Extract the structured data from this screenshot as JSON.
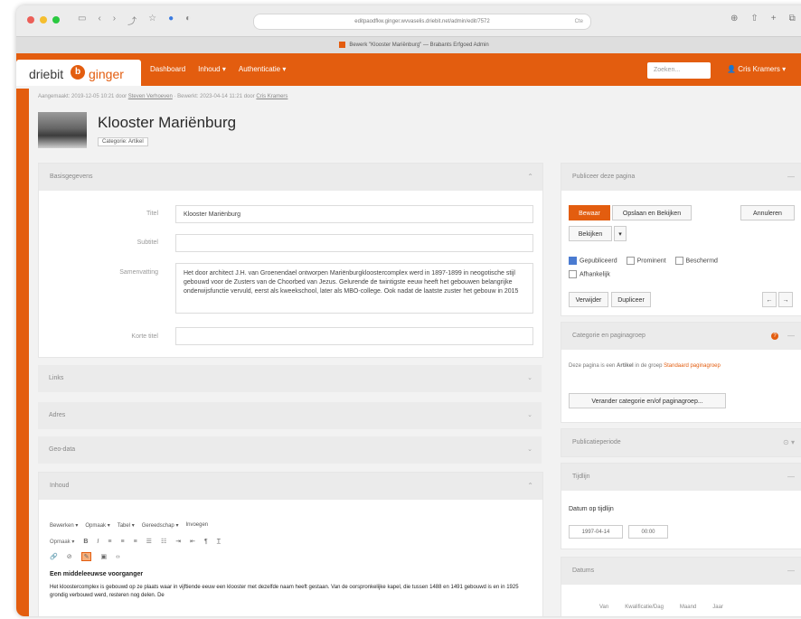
{
  "browser": {
    "url": "editpaodfkw.ginger.wvvaselis.driebit.net/admin/edit/7572",
    "url_right": "Cte",
    "tab_title": "Bewerk \"Klooster Mariënburg\" — Brabants Erfgoed Admin"
  },
  "nav": {
    "logo_left": "driebit",
    "logo_badge": "b",
    "logo_right": "ginger",
    "links": [
      "Dashboard",
      "Inhoud ▾",
      "Authenticatie ▾"
    ],
    "search_placeholder": "Zoeken...",
    "user": "Cris Kramers ▾"
  },
  "sidebar_label": "",
  "page": {
    "meta_prefix": "Aangemaakt: 2019-12-05 10:21 door",
    "meta_user1": "Steven Verhoeven",
    "meta_mid": "· Bewerkt: 2023-04-14 11:21 door",
    "meta_user2": "Cris Kramers",
    "title": "Klooster Mariënburg",
    "category": "Categorie: Artikel"
  },
  "basics": {
    "header": "Basisgegevens",
    "title_label": "Titel",
    "title_value": "Klooster Mariënburg",
    "subtitle_label": "Subtitel",
    "subtitle_value": "",
    "summary_label": "Samenvatting",
    "summary_value": "Het door architect J.H. van Groenendael ontworpen Mariënburgkloostercomplex werd in 1897-1899 in neogotische stijl gebouwd voor de Zusters van de Choorbed van Jezus. Gelurende de twintigste eeuw heeft het gebouwen belangrijke onderwijsfunctie vervuld, eerst als kweekschool, later als MBO-college. Ook nadat de laatste zuster het gebouw in 2015",
    "short_label": "Korte titel",
    "short_value": ""
  },
  "sections": [
    "Links",
    "Adres",
    "Geo-data"
  ],
  "content": {
    "header": "Inhoud",
    "menus": [
      "Bewerken ▾",
      "Opmaak ▾",
      "Tabel ▾",
      "Gereedschap ▾",
      "Invoegen"
    ],
    "format": "Opmaak ▾",
    "heading": "Een middeleeuwse voorganger",
    "para": "Het kloostercomplex is gebouwd op ze plaats waar in vijftiende eeuw een klooster met dezelfde naam heeft gestaan. Van de oorspronkelijke kapel, die tussen 1488 en 1491 gebouwd is en in 1925 grondig verbouwd werd, resteren nog delen. De"
  },
  "publish": {
    "header": "Publiceer deze pagina",
    "save": "Bewaar",
    "save_view": "Opslaan en Bekijken",
    "cancel": "Annuleren",
    "view": "Bekijken",
    "view_more": "▾",
    "published": "Gepubliceerd",
    "prominent": "Prominent",
    "protect": "Beschermd",
    "dependent": "Afhankelijk",
    "delete": "Verwijder",
    "duplicate": "Dupliceer",
    "prev": "←",
    "next": "→"
  },
  "category_panel": {
    "header": "Categorie en paginagroep",
    "text_a": "Deze pagina is een",
    "text_b": "Artikel",
    "text_c": "in de groep",
    "text_d": "Standaard paginagroep",
    "button": "Verander categorie en/of paginagroep..."
  },
  "pub_period": {
    "header": "Publicatieperiode",
    "icons": "⊙ ▾"
  },
  "time_panel": {
    "header": "Tijdlijn",
    "label": "Datum op tijdlijn",
    "date": "1997-04-14",
    "time": "00:00"
  },
  "dates_panel": {
    "header": "Datums",
    "cols": [
      "Van",
      "Kwalificatie/Dag",
      "Maand",
      "Jaar"
    ]
  },
  "colors": {
    "accent": "#e35d0f",
    "check": "#4a7bd1"
  }
}
